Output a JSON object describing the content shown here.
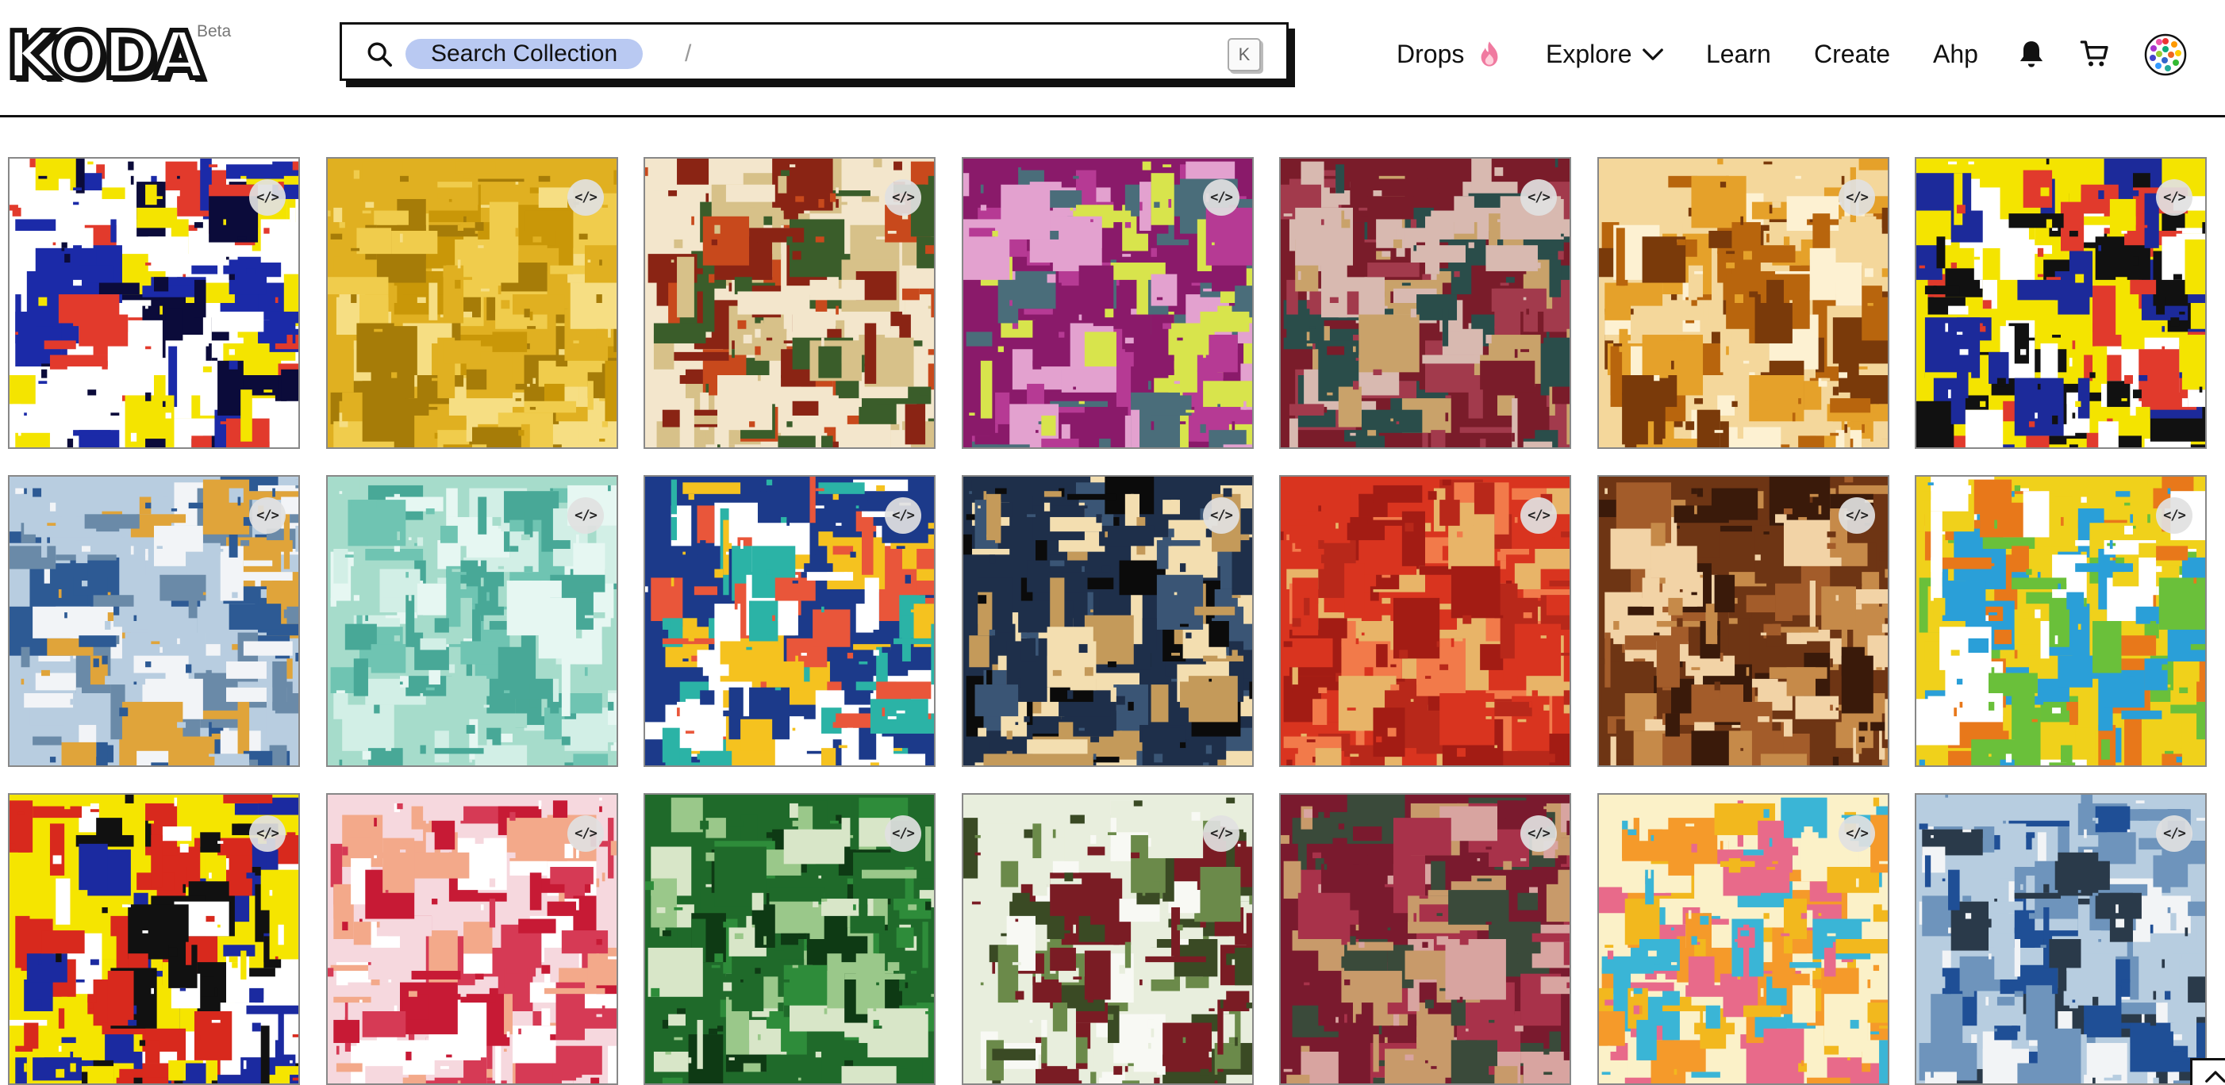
{
  "header": {
    "logo_text": "KODA",
    "beta_label": "Beta",
    "search": {
      "chip_label": "Search Collection",
      "slash": "/",
      "shortcut_key": "K"
    },
    "nav": {
      "drops": "Drops",
      "explore": "Explore",
      "learn": "Learn",
      "create": "Create",
      "account": "Ahp"
    },
    "icons": [
      "search-icon",
      "fire-icon",
      "chevron-down-icon",
      "bell-icon",
      "cart-icon",
      "avatar"
    ]
  },
  "grid": {
    "code_label": "</>",
    "tiles": [
      {
        "colors": [
          "#ffffff",
          "#1b2aa8",
          "#f4e400",
          "#e23a2c",
          "#0b0b3a"
        ]
      },
      {
        "colors": [
          "#e0b021",
          "#c99708",
          "#f0cc4c",
          "#a67c08",
          "#f6de83"
        ]
      },
      {
        "colors": [
          "#f3e6cc",
          "#c8491c",
          "#8a2414",
          "#3a5d2a",
          "#d7c189"
        ]
      },
      {
        "colors": [
          "#8a1a6a",
          "#b63a94",
          "#e3a1cf",
          "#4a6d7a",
          "#d8e44c"
        ]
      },
      {
        "colors": [
          "#7a1c2a",
          "#a23a4c",
          "#c9a26a",
          "#2a4d4a",
          "#d8b9b0"
        ]
      },
      {
        "colors": [
          "#f4d79b",
          "#e5a12a",
          "#fdf1d2",
          "#b8650d",
          "#7a3a0a"
        ]
      },
      {
        "colors": [
          "#f4e400",
          "#1c2a9a",
          "#e13a2c",
          "#ffffff",
          "#111111"
        ]
      },
      {
        "colors": [
          "#b8cde0",
          "#2d5a94",
          "#e0a43a",
          "#f2f4f7",
          "#6a8aa8"
        ]
      },
      {
        "colors": [
          "#a6dccb",
          "#6fc4b2",
          "#d2efe6",
          "#48a897",
          "#e6f7f2"
        ]
      },
      {
        "colors": [
          "#1c3a8a",
          "#e9563a",
          "#2bb3a6",
          "#f5c21f",
          "#ffffff"
        ]
      },
      {
        "colors": [
          "#1e2f4a",
          "#f3deb0",
          "#0b0b0b",
          "#c49a5a",
          "#3a5575"
        ]
      },
      {
        "colors": [
          "#d9341f",
          "#b8281a",
          "#e8b468",
          "#f27a4a",
          "#a31c14"
        ]
      },
      {
        "colors": [
          "#6e3514",
          "#c68a49",
          "#f2d3a6",
          "#3a1a0a",
          "#a35c2a"
        ]
      },
      {
        "colors": [
          "#f0d11b",
          "#2a9fd8",
          "#e8781a",
          "#6ac03a",
          "#ffffff"
        ]
      },
      {
        "colors": [
          "#f5e500",
          "#d8291d",
          "#1b2aa0",
          "#ffffff",
          "#111111"
        ]
      },
      {
        "colors": [
          "#f6d8de",
          "#d63a55",
          "#f3a98a",
          "#ffffff",
          "#c71a35"
        ]
      },
      {
        "colors": [
          "#1f6a2a",
          "#2e8c3a",
          "#9ac88a",
          "#0e3a14",
          "#d8e6c8"
        ]
      },
      {
        "colors": [
          "#e8eedd",
          "#6b8a4a",
          "#7a1c24",
          "#f8f9f4",
          "#3a4a24"
        ]
      },
      {
        "colors": [
          "#7a1a2e",
          "#a8324a",
          "#d8a4a0",
          "#3a4a3a",
          "#c89a6a"
        ]
      },
      {
        "colors": [
          "#fbf1c8",
          "#f2b81e",
          "#e86a8a",
          "#3ab5d6",
          "#f59a2a"
        ]
      },
      {
        "colors": [
          "#b7cde0",
          "#1f4f96",
          "#f2f4f6",
          "#2a3a4a",
          "#6e94bc"
        ]
      }
    ]
  }
}
